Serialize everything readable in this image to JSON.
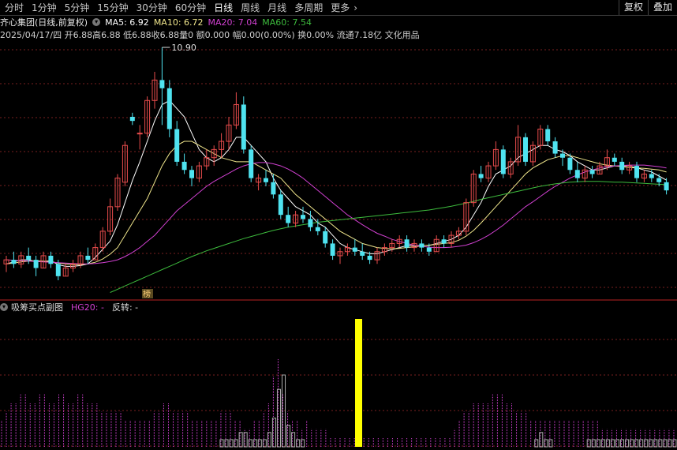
{
  "toolbar": {
    "tabs": [
      {
        "label": "分时"
      },
      {
        "label": "1分钟"
      },
      {
        "label": "5分钟"
      },
      {
        "label": "15分钟"
      },
      {
        "label": "30分钟"
      },
      {
        "label": "60分钟"
      },
      {
        "label": "日线"
      },
      {
        "label": "周线"
      },
      {
        "label": "月线"
      },
      {
        "label": "多周期"
      },
      {
        "label": "更多"
      }
    ],
    "more_icon": "chevron-right-icon",
    "active_tab": "日线",
    "restore_label": "复权",
    "overlay_label": "叠加"
  },
  "header": {
    "stock_title": "齐心集团(日线,前复权)",
    "settings_icon": "chevron-down-icon",
    "ma5": "MA5: 6.92",
    "ma10": "MA10: 6.72",
    "ma20": "MA20: 7.04",
    "ma60": "MA60: 7.54",
    "date": "2025/04/17/四",
    "open": "开6.88",
    "high": "高6.88",
    "low": "低6.88",
    "close": "收6.88",
    "volume": "量0",
    "amount": "额0.000",
    "change": "幅0.00(0.00%)",
    "turnover": "换0.00%",
    "float_cap": "流通7.18亿",
    "sector": "文化用品"
  },
  "colors": {
    "up": "#e84c4c",
    "down": "#4fe3f0",
    "ma5": "#ffffff",
    "ma10": "#f0e68c",
    "ma20": "#d040d0",
    "ma60": "#3dbb3d",
    "signal": "#ffff00",
    "hg20": "#d040d0"
  },
  "main": {
    "high_label": "10.90",
    "marker_label": "榜"
  },
  "sub": {
    "title": "吸筹买点副图",
    "hg20": "HG20: -",
    "reversal": "反转: -"
  },
  "chart_data": {
    "type": "candlestick",
    "candles": [
      [
        5.6,
        5.8,
        5.4,
        5.7
      ],
      [
        5.7,
        5.9,
        5.5,
        5.6
      ],
      [
        5.6,
        5.9,
        5.5,
        5.8
      ],
      [
        5.8,
        6.0,
        5.6,
        5.7
      ],
      [
        5.7,
        5.8,
        5.3,
        5.5
      ],
      [
        5.5,
        5.9,
        5.5,
        5.8
      ],
      [
        5.8,
        5.9,
        5.5,
        5.6
      ],
      [
        5.6,
        5.7,
        5.2,
        5.3
      ],
      [
        5.3,
        5.6,
        5.3,
        5.5
      ],
      [
        5.5,
        5.7,
        5.4,
        5.6
      ],
      [
        5.6,
        5.9,
        5.5,
        5.8
      ],
      [
        5.8,
        6.0,
        5.6,
        5.7
      ],
      [
        5.7,
        6.1,
        5.7,
        6.0
      ],
      [
        6.0,
        6.5,
        5.9,
        6.4
      ],
      [
        6.4,
        7.2,
        6.3,
        7.0
      ],
      [
        7.0,
        7.8,
        6.9,
        7.7
      ],
      [
        7.6,
        8.6,
        7.5,
        8.5
      ],
      [
        9.2,
        9.3,
        9.0,
        9.1
      ],
      [
        8.8,
        9.0,
        8.4,
        8.8
      ],
      [
        8.8,
        9.7,
        8.7,
        9.6
      ],
      [
        9.6,
        10.3,
        9.4,
        10.1
      ],
      [
        10.1,
        10.9,
        9.0,
        9.9
      ],
      [
        9.9,
        10.1,
        8.7,
        8.9
      ],
      [
        8.9,
        9.1,
        8.0,
        8.1
      ],
      [
        8.1,
        8.3,
        7.8,
        7.9
      ],
      [
        7.9,
        8.0,
        7.5,
        7.7
      ],
      [
        7.7,
        8.1,
        7.6,
        8.0
      ],
      [
        8.0,
        8.4,
        7.9,
        8.2
      ],
      [
        8.2,
        8.5,
        8.0,
        8.4
      ],
      [
        8.4,
        8.8,
        8.2,
        8.6
      ],
      [
        8.6,
        9.2,
        8.4,
        9.0
      ],
      [
        9.0,
        9.8,
        8.9,
        9.5
      ],
      [
        9.5,
        9.7,
        8.3,
        8.4
      ],
      [
        8.4,
        8.5,
        7.6,
        7.7
      ],
      [
        7.6,
        7.8,
        7.4,
        7.7
      ],
      [
        7.7,
        7.9,
        7.5,
        7.6
      ],
      [
        7.6,
        7.8,
        7.2,
        7.3
      ],
      [
        7.3,
        7.4,
        6.7,
        6.8
      ],
      [
        6.8,
        7.0,
        6.5,
        6.6
      ],
      [
        6.6,
        6.9,
        6.5,
        6.8
      ],
      [
        6.8,
        7.0,
        6.6,
        6.7
      ],
      [
        6.7,
        6.9,
        6.4,
        6.5
      ],
      [
        6.5,
        6.7,
        6.3,
        6.4
      ],
      [
        6.4,
        6.5,
        6.0,
        6.1
      ],
      [
        6.1,
        6.2,
        5.7,
        5.8
      ],
      [
        5.8,
        6.0,
        5.6,
        5.9
      ],
      [
        5.9,
        6.1,
        5.8,
        6.0
      ],
      [
        6.0,
        6.2,
        5.8,
        5.9
      ],
      [
        5.9,
        6.1,
        5.7,
        5.8
      ],
      [
        5.8,
        5.9,
        5.6,
        5.7
      ],
      [
        5.7,
        6.0,
        5.6,
        5.9
      ],
      [
        5.9,
        6.1,
        5.8,
        6.0
      ],
      [
        6.0,
        6.2,
        5.9,
        6.1
      ],
      [
        6.1,
        6.3,
        6.0,
        6.2
      ],
      [
        6.2,
        6.3,
        5.9,
        6.0
      ],
      [
        6.0,
        6.2,
        5.9,
        6.1
      ],
      [
        6.1,
        6.2,
        5.9,
        6.0
      ],
      [
        6.0,
        6.1,
        5.8,
        5.9
      ],
      [
        5.9,
        6.3,
        5.9,
        6.2
      ],
      [
        6.2,
        6.3,
        6.0,
        6.1
      ],
      [
        6.1,
        6.4,
        6.0,
        6.3
      ],
      [
        6.3,
        6.5,
        6.2,
        6.4
      ],
      [
        6.4,
        7.2,
        6.3,
        7.1
      ],
      [
        7.1,
        7.9,
        7.0,
        7.8
      ],
      [
        7.8,
        8.0,
        7.6,
        7.7
      ],
      [
        7.7,
        8.1,
        7.6,
        8.0
      ],
      [
        8.0,
        8.6,
        7.9,
        8.4
      ],
      [
        8.4,
        8.5,
        7.7,
        7.8
      ],
      [
        7.8,
        8.2,
        7.7,
        8.1
      ],
      [
        8.1,
        9.0,
        8.0,
        8.7
      ],
      [
        8.7,
        8.8,
        8.0,
        8.1
      ],
      [
        8.1,
        8.6,
        8.0,
        8.5
      ],
      [
        8.5,
        9.0,
        8.4,
        8.9
      ],
      [
        8.9,
        9.0,
        8.5,
        8.6
      ],
      [
        8.6,
        8.7,
        8.2,
        8.3
      ],
      [
        8.3,
        8.4,
        8.0,
        8.2
      ],
      [
        8.2,
        8.3,
        7.8,
        7.9
      ],
      [
        7.9,
        8.1,
        7.6,
        7.7
      ],
      [
        7.7,
        8.0,
        7.6,
        7.9
      ],
      [
        7.9,
        8.0,
        7.7,
        7.8
      ],
      [
        7.8,
        8.1,
        7.8,
        8.0
      ],
      [
        8.0,
        8.4,
        7.9,
        8.2
      ],
      [
        8.2,
        8.3,
        8.0,
        8.1
      ],
      [
        8.1,
        8.2,
        7.8,
        7.9
      ],
      [
        7.9,
        8.1,
        7.8,
        8.0
      ],
      [
        8.0,
        8.1,
        7.6,
        7.7
      ],
      [
        7.7,
        7.9,
        7.6,
        7.8
      ],
      [
        7.8,
        7.9,
        7.6,
        7.7
      ],
      [
        7.7,
        7.8,
        7.5,
        7.6
      ],
      [
        7.6,
        7.7,
        7.3,
        7.4
      ]
    ],
    "ma_series": [
      {
        "name": "MA5",
        "values": [
          5.6,
          5.65,
          5.7,
          5.7,
          5.66,
          5.66,
          5.68,
          5.58,
          5.54,
          5.54,
          5.56,
          5.6,
          5.76,
          5.96,
          6.16,
          6.56,
          7.1,
          7.64,
          8.1,
          8.6,
          9.1,
          9.5,
          9.6,
          9.4,
          9.2,
          8.8,
          8.4,
          8.2,
          8.1,
          8.2,
          8.4,
          8.7,
          8.7,
          8.5,
          8.3,
          8.1,
          7.7,
          7.4,
          7.2,
          7.0,
          6.9,
          6.8,
          6.6,
          6.5,
          6.3,
          6.1,
          6.0,
          5.95,
          5.9,
          5.85,
          5.85,
          5.9,
          5.95,
          6.0,
          6.05,
          6.05,
          6.05,
          6.05,
          6.1,
          6.15,
          6.2,
          6.3,
          6.5,
          6.8,
          7.1,
          7.5,
          7.8,
          7.9,
          8.0,
          8.2,
          8.3,
          8.4,
          8.5,
          8.5,
          8.4,
          8.35,
          8.25,
          8.1,
          8.0,
          7.9,
          7.9,
          7.95,
          8.0,
          8.0,
          8.0,
          7.95,
          7.9,
          7.85,
          7.75,
          7.65
        ]
      },
      {
        "name": "MA10",
        "values": [
          5.6,
          5.62,
          5.65,
          5.67,
          5.68,
          5.67,
          5.66,
          5.62,
          5.6,
          5.58,
          5.58,
          5.6,
          5.64,
          5.72,
          5.84,
          6.0,
          6.3,
          6.6,
          6.9,
          7.2,
          7.6,
          8.0,
          8.3,
          8.5,
          8.6,
          8.6,
          8.5,
          8.4,
          8.3,
          8.2,
          8.15,
          8.1,
          8.1,
          8.1,
          8.0,
          7.9,
          7.8,
          7.7,
          7.5,
          7.3,
          7.15,
          7.0,
          6.85,
          6.7,
          6.55,
          6.4,
          6.3,
          6.2,
          6.1,
          6.05,
          6.0,
          5.98,
          5.97,
          5.98,
          6.0,
          6.02,
          6.04,
          6.06,
          6.08,
          6.1,
          6.12,
          6.18,
          6.28,
          6.42,
          6.6,
          6.8,
          7.0,
          7.2,
          7.4,
          7.6,
          7.8,
          7.95,
          8.05,
          8.15,
          8.2,
          8.25,
          8.25,
          8.2,
          8.15,
          8.1,
          8.05,
          8.02,
          8.0,
          7.98,
          7.96,
          7.95,
          7.94,
          7.92,
          7.9,
          7.85
        ]
      },
      {
        "name": "MA20",
        "values": [
          5.7,
          5.69,
          5.68,
          5.67,
          5.66,
          5.65,
          5.64,
          5.63,
          5.62,
          5.61,
          5.6,
          5.6,
          5.61,
          5.63,
          5.66,
          5.7,
          5.78,
          5.88,
          6.0,
          6.15,
          6.3,
          6.5,
          6.7,
          6.9,
          7.05,
          7.2,
          7.35,
          7.5,
          7.62,
          7.72,
          7.82,
          7.92,
          8.0,
          8.05,
          8.08,
          8.08,
          8.05,
          8.0,
          7.92,
          7.82,
          7.7,
          7.55,
          7.4,
          7.25,
          7.1,
          6.95,
          6.8,
          6.68,
          6.56,
          6.45,
          6.35,
          6.28,
          6.2,
          6.15,
          6.1,
          6.06,
          6.03,
          6.01,
          6.0,
          6.0,
          6.01,
          6.03,
          6.06,
          6.12,
          6.2,
          6.3,
          6.42,
          6.55,
          6.7,
          6.85,
          7.0,
          7.12,
          7.25,
          7.38,
          7.5,
          7.6,
          7.7,
          7.78,
          7.85,
          7.9,
          7.95,
          7.98,
          8.0,
          8.01,
          8.02,
          8.02,
          8.02,
          8.0,
          7.98,
          7.95
        ]
      },
      {
        "name": "MA60",
        "values": [
          null,
          null,
          null,
          null,
          null,
          null,
          null,
          null,
          null,
          null,
          null,
          null,
          null,
          null,
          4.9,
          4.98,
          5.06,
          5.14,
          5.22,
          5.3,
          5.38,
          5.46,
          5.54,
          5.62,
          5.7,
          5.78,
          5.85,
          5.92,
          5.98,
          6.04,
          6.1,
          6.16,
          6.22,
          6.27,
          6.32,
          6.37,
          6.42,
          6.46,
          6.5,
          6.53,
          6.56,
          6.59,
          6.62,
          6.64,
          6.66,
          6.68,
          6.7,
          6.72,
          6.74,
          6.76,
          6.78,
          6.8,
          6.82,
          6.84,
          6.86,
          6.88,
          6.9,
          6.92,
          6.95,
          6.98,
          7.01,
          7.05,
          7.09,
          7.13,
          7.18,
          7.22,
          7.26,
          7.3,
          7.34,
          7.38,
          7.42,
          7.46,
          7.5,
          7.53,
          7.56,
          7.58,
          7.6,
          7.61,
          7.62,
          7.62,
          7.62,
          7.61,
          7.6,
          7.6,
          7.59,
          7.58,
          7.57,
          7.56,
          7.55,
          7.54
        ]
      }
    ],
    "sub_bars": [
      3,
      4,
      5,
      5,
      6,
      6,
      5,
      5,
      6,
      6,
      5,
      5,
      6,
      6,
      5,
      5,
      6,
      6,
      5,
      5,
      5,
      4,
      4,
      4,
      4,
      4,
      3,
      3,
      3,
      3,
      3,
      3,
      4,
      4,
      5,
      5,
      4,
      4,
      4,
      4,
      3,
      3,
      3,
      3,
      3,
      3,
      4,
      4,
      4,
      3,
      3,
      2,
      2,
      3,
      3,
      4,
      5,
      8,
      10,
      6,
      4,
      3,
      3,
      2,
      3,
      2,
      2,
      2,
      2,
      1,
      1,
      1,
      1,
      1,
      1,
      1,
      1,
      1,
      1,
      1,
      1,
      1,
      1,
      1,
      1,
      1,
      1,
      1,
      1,
      1,
      1,
      1,
      1,
      1,
      1,
      2,
      3,
      4,
      4,
      5,
      5,
      5,
      5,
      6,
      6,
      6,
      5,
      5,
      4,
      4,
      4,
      3,
      3,
      3,
      3,
      3,
      3,
      3,
      3,
      3,
      3,
      3,
      3,
      3,
      3,
      3,
      2,
      2,
      2,
      2,
      2,
      2,
      2,
      2,
      2,
      2,
      2,
      2,
      2,
      2,
      2,
      2
    ],
    "sub_gray": [
      0,
      0,
      0,
      0,
      0,
      0,
      0,
      0,
      0,
      0,
      0,
      0,
      0,
      0,
      0,
      0,
      0,
      0,
      0,
      0,
      0,
      0,
      0,
      0,
      0,
      0,
      0,
      0,
      0,
      0,
      0,
      0,
      0,
      0,
      0,
      0,
      0,
      0,
      0,
      0,
      0,
      0,
      0,
      0,
      0,
      0,
      1,
      1,
      1,
      1,
      2,
      2,
      1,
      1,
      1,
      1,
      2,
      4,
      8,
      10,
      3,
      2,
      1,
      1,
      0,
      0,
      0,
      0,
      0,
      0,
      0,
      0,
      0,
      0,
      0,
      0,
      0,
      0,
      0,
      0,
      0,
      0,
      0,
      0,
      0,
      0,
      0,
      0,
      0,
      0,
      0,
      0,
      0,
      0,
      0,
      0,
      0,
      0,
      0,
      0,
      0,
      0,
      0,
      0,
      0,
      0,
      0,
      0,
      0,
      0,
      0,
      0,
      1,
      2,
      1,
      1,
      0,
      0,
      0,
      0,
      0,
      0,
      0,
      1,
      1,
      1,
      1,
      1,
      1,
      1,
      1,
      1,
      1,
      1,
      1,
      1,
      1,
      1,
      1,
      1,
      1,
      1
    ],
    "signal_index": 66
  }
}
